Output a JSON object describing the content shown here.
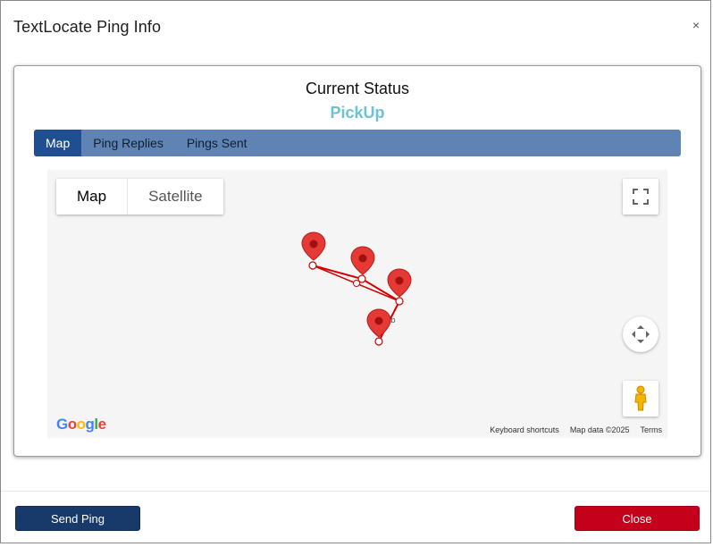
{
  "modal": {
    "title": "TextLocate Ping Info",
    "close_glyph": "×"
  },
  "status": {
    "heading": "Current Status",
    "value": "PickUp",
    "value_color": "#6cc3d5"
  },
  "tabs": [
    {
      "label": "Map",
      "active": true
    },
    {
      "label": "Ping Replies",
      "active": false
    },
    {
      "label": "Pings Sent",
      "active": false
    }
  ],
  "map": {
    "map_type_options": [
      {
        "label": "Map",
        "active": true
      },
      {
        "label": "Satellite",
        "active": false
      }
    ],
    "controls": [
      "fullscreen-icon",
      "camera-control-icon",
      "pegman-icon"
    ],
    "logo_text": [
      "G",
      "o",
      "o",
      "g",
      "l",
      "e"
    ],
    "logo_colors": [
      "#4285f4",
      "#ea4335",
      "#fbbc05",
      "#4285f4",
      "#34a853",
      "#ea4335"
    ],
    "footer": {
      "shortcuts": "Keyboard shortcuts",
      "map_data": "Map data ©2025",
      "terms": "Terms"
    },
    "marker_color": "#e53935",
    "route_color": "#d40000"
  },
  "footer": {
    "send_label": "Send Ping",
    "close_label": "Close",
    "send_color": "#173a6b",
    "close_color": "#c4001a"
  }
}
